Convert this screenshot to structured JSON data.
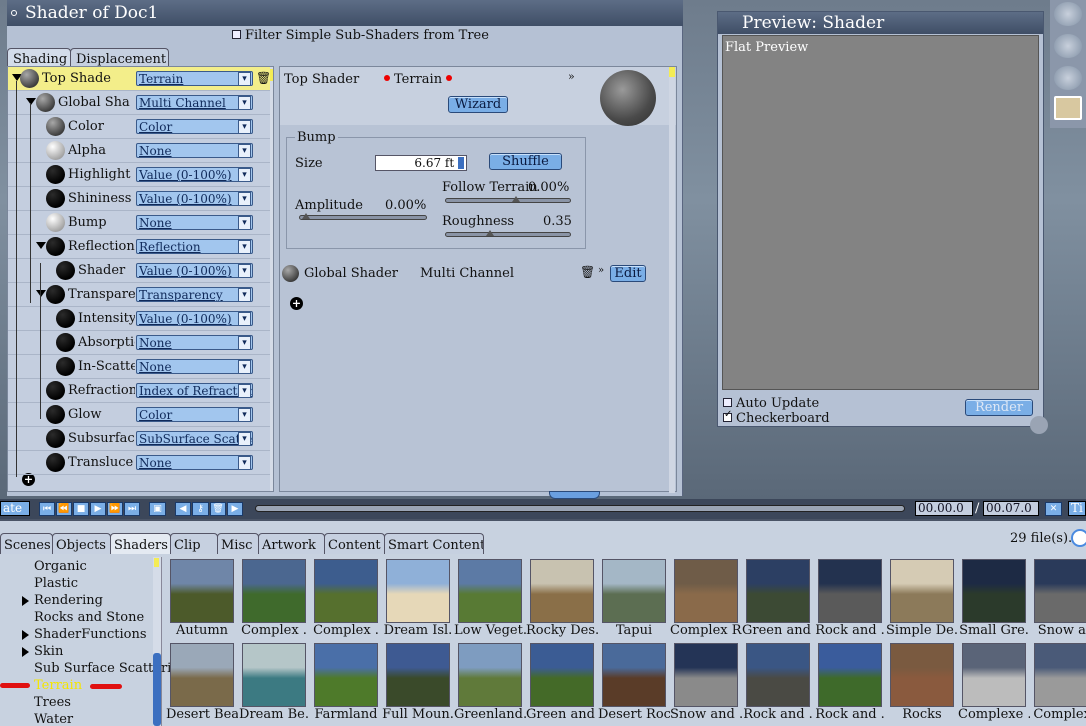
{
  "shader_window": {
    "title": "Shader of Doc1",
    "filter_label": "Filter Simple Sub-Shaders from Tree",
    "tabs": [
      "Shading",
      "Displacement"
    ]
  },
  "tree": {
    "rows": [
      {
        "label": "Top Shade",
        "value": "Terrain",
        "sphere": "grey"
      },
      {
        "label": "Global Sha",
        "value": "Multi Channel",
        "sphere": "grey"
      },
      {
        "label": "Color",
        "value": "Color",
        "sphere": "grey"
      },
      {
        "label": "Alpha",
        "value": "None",
        "sphere": "light"
      },
      {
        "label": "Highlight",
        "value": "Value (0-100%)",
        "sphere": "black"
      },
      {
        "label": "Shininess",
        "value": "Value (0-100%)",
        "sphere": "black"
      },
      {
        "label": "Bump",
        "value": "None",
        "sphere": "light"
      },
      {
        "label": "Reflection",
        "value": "Reflection",
        "sphere": "black"
      },
      {
        "label": "Shader",
        "value": "Value (0-100%)",
        "sphere": "black"
      },
      {
        "label": "Transpare",
        "value": "Transparency",
        "sphere": "black"
      },
      {
        "label": "Intensity",
        "value": "Value (0-100%)",
        "sphere": "black"
      },
      {
        "label": "Absorptio",
        "value": "None",
        "sphere": "black"
      },
      {
        "label": "In-Scatter",
        "value": "None",
        "sphere": "black"
      },
      {
        "label": "Refraction",
        "value": "Index of Refraction",
        "sphere": "black"
      },
      {
        "label": "Glow",
        "value": "Color",
        "sphere": "black"
      },
      {
        "label": "Subsurfac",
        "value": "SubSurface Scattering",
        "sphere": "black"
      },
      {
        "label": "Transluce",
        "value": "None",
        "sphere": "black"
      }
    ]
  },
  "editor": {
    "title": "Top Shader",
    "type": "Terrain",
    "wizard": "Wizard",
    "bump": {
      "title": "Bump",
      "size_label": "Size",
      "size_value": "6.67 ft",
      "shuffle": "Shuffle",
      "follow_label": "Follow Terrain",
      "follow_value": "0.00%",
      "amplitude_label": "Amplitude",
      "amplitude_value": "0.00%",
      "roughness_label": "Roughness",
      "roughness_value": "0.35"
    },
    "global": {
      "label": "Global Shader",
      "type": "Multi Channel",
      "edit": "Edit"
    }
  },
  "preview": {
    "title": "Preview: Shader",
    "canvas_label": "Flat Preview",
    "auto_update": "Auto Update",
    "auto_update_checked": false,
    "checkerboard": "Checkerboard",
    "checkerboard_checked": true,
    "render": "Render"
  },
  "timeline": {
    "left_label": "ate",
    "time_current": "00.00.0",
    "separator": "/",
    "time_total": "00.07.0",
    "right_label": "Ti"
  },
  "library": {
    "tabs": [
      "Scenes",
      "Objects",
      "Shaders",
      "Clip",
      "Misc",
      "Artwork",
      "Content",
      "Smart Content"
    ],
    "file_count": "29 file(s).",
    "categories": [
      {
        "label": "Organic",
        "expandable": false
      },
      {
        "label": "Plastic",
        "expandable": false
      },
      {
        "label": "Rendering",
        "expandable": true
      },
      {
        "label": "Rocks and Stone",
        "expandable": false
      },
      {
        "label": "ShaderFunctions",
        "expandable": true
      },
      {
        "label": "Skin",
        "expandable": true
      },
      {
        "label": "Sub Surface Scattering",
        "expandable": false
      },
      {
        "label": "Terrain",
        "expandable": false,
        "selected": true
      },
      {
        "label": "Trees",
        "expandable": false
      },
      {
        "label": "Water",
        "expandable": false
      }
    ],
    "row1": [
      "Autumn",
      "Complex .",
      "Complex .",
      "Dream Isl.",
      "Low Veget.",
      "Rocky Des.",
      "Tapui",
      "Complex R.",
      "Green and .",
      "Rock and .",
      "Simple De.",
      "Small Gre.",
      "Snow an"
    ],
    "row2": [
      "Desert Bea.",
      "Dream Be.",
      "Farmland",
      "Full Moun.",
      "Greenland.",
      "Green and .",
      "Desert Roc.",
      "Snow and .",
      "Rock and .",
      "Rock and .",
      "Rocks",
      "Complexe .",
      "Complexe"
    ],
    "accent_color": "#7aaee6",
    "selected_color": "#f5e600"
  }
}
